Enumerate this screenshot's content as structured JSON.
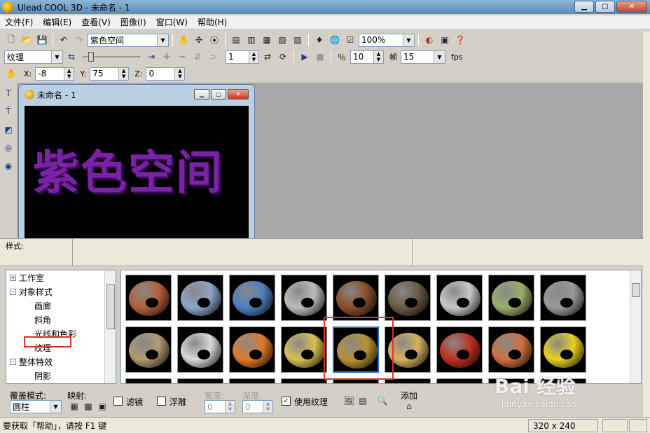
{
  "window": {
    "title": "Ulead COOL 3D - 未命名 - 1"
  },
  "menu": [
    "文件(F)",
    "编辑(E)",
    "查看(V)",
    "图像(I)",
    "窗口(W)",
    "帮助(H)"
  ],
  "toolbar1": {
    "text_combo": "紫色空间",
    "zoom_combo": "100%"
  },
  "toolbar2": {
    "attr_combo": "纹理",
    "frame_value": "1",
    "frames_value": "10",
    "frames_label": "帧",
    "fps_value": "15",
    "fps_label": "fps"
  },
  "toolbar3": {
    "x_label": "X:",
    "x_value": "-8",
    "y_label": "Y:",
    "y_value": "75",
    "z_label": "Z:",
    "z_value": "0"
  },
  "document": {
    "title": "未命名 - 1",
    "canvas_text": "紫色空间"
  },
  "style_panel": {
    "label": "样式:"
  },
  "tree": {
    "items": [
      {
        "label": "工作室",
        "expander": "+",
        "level": 0
      },
      {
        "label": "对象样式",
        "expander": "-",
        "level": 0
      },
      {
        "label": "画廊",
        "level": 1
      },
      {
        "label": "斜角",
        "level": 1
      },
      {
        "label": "光线和色彩",
        "level": 1
      },
      {
        "label": "纹理",
        "level": 1
      },
      {
        "label": "整体特效",
        "expander": "-",
        "level": 0
      },
      {
        "label": "阴影",
        "level": 1
      }
    ]
  },
  "gallery": {
    "selected_index": 13,
    "thumbnails": [
      {
        "name": "brick-texture",
        "color": "#b5603a"
      },
      {
        "name": "blue-white-marble",
        "color": "#8ea4c8"
      },
      {
        "name": "blue-stone",
        "color": "#4f7fc0"
      },
      {
        "name": "white-brick",
        "color": "#bcbcbc"
      },
      {
        "name": "rusty-metal",
        "color": "#8a4e2a"
      },
      {
        "name": "dark-rock",
        "color": "#6a5a44"
      },
      {
        "name": "silver-crumple",
        "color": "#c8c8c8"
      },
      {
        "name": "green-moss",
        "color": "#9aae6a"
      },
      {
        "name": "grey-stone",
        "color": "#9a9a9a"
      },
      {
        "name": "tan-sand",
        "color": "#b29a70"
      },
      {
        "name": "chrome",
        "color": "#d8d8d8"
      },
      {
        "name": "orange-plastic",
        "color": "#e07a28"
      },
      {
        "name": "gold-light",
        "color": "#d8c050"
      },
      {
        "name": "gold-dark",
        "color": "#b89030"
      },
      {
        "name": "gold-shiny",
        "color": "#d8b060"
      },
      {
        "name": "red-brick",
        "color": "#c03020"
      },
      {
        "name": "orange-brick",
        "color": "#d07040"
      },
      {
        "name": "yellow-plastic",
        "color": "#e8d020"
      }
    ]
  },
  "bottom": {
    "overlay_mode_label": "覆盖模式:",
    "overlay_mode_value": "圆柱",
    "mapping_label": "映射:",
    "filter_label": "滤镜",
    "emboss_label": "浮雕",
    "width_label": "宽度:",
    "width_value": "0",
    "depth_label": "深度:",
    "depth_value": "0",
    "use_texture_label": "使用纹理",
    "add_label": "添加"
  },
  "status": {
    "help_text": "要获取「帮助」，请按 F1 键",
    "size_text": "320 x 240"
  },
  "watermark": {
    "main": "Bai 经验",
    "sub": "jingyan.baidu.com"
  }
}
